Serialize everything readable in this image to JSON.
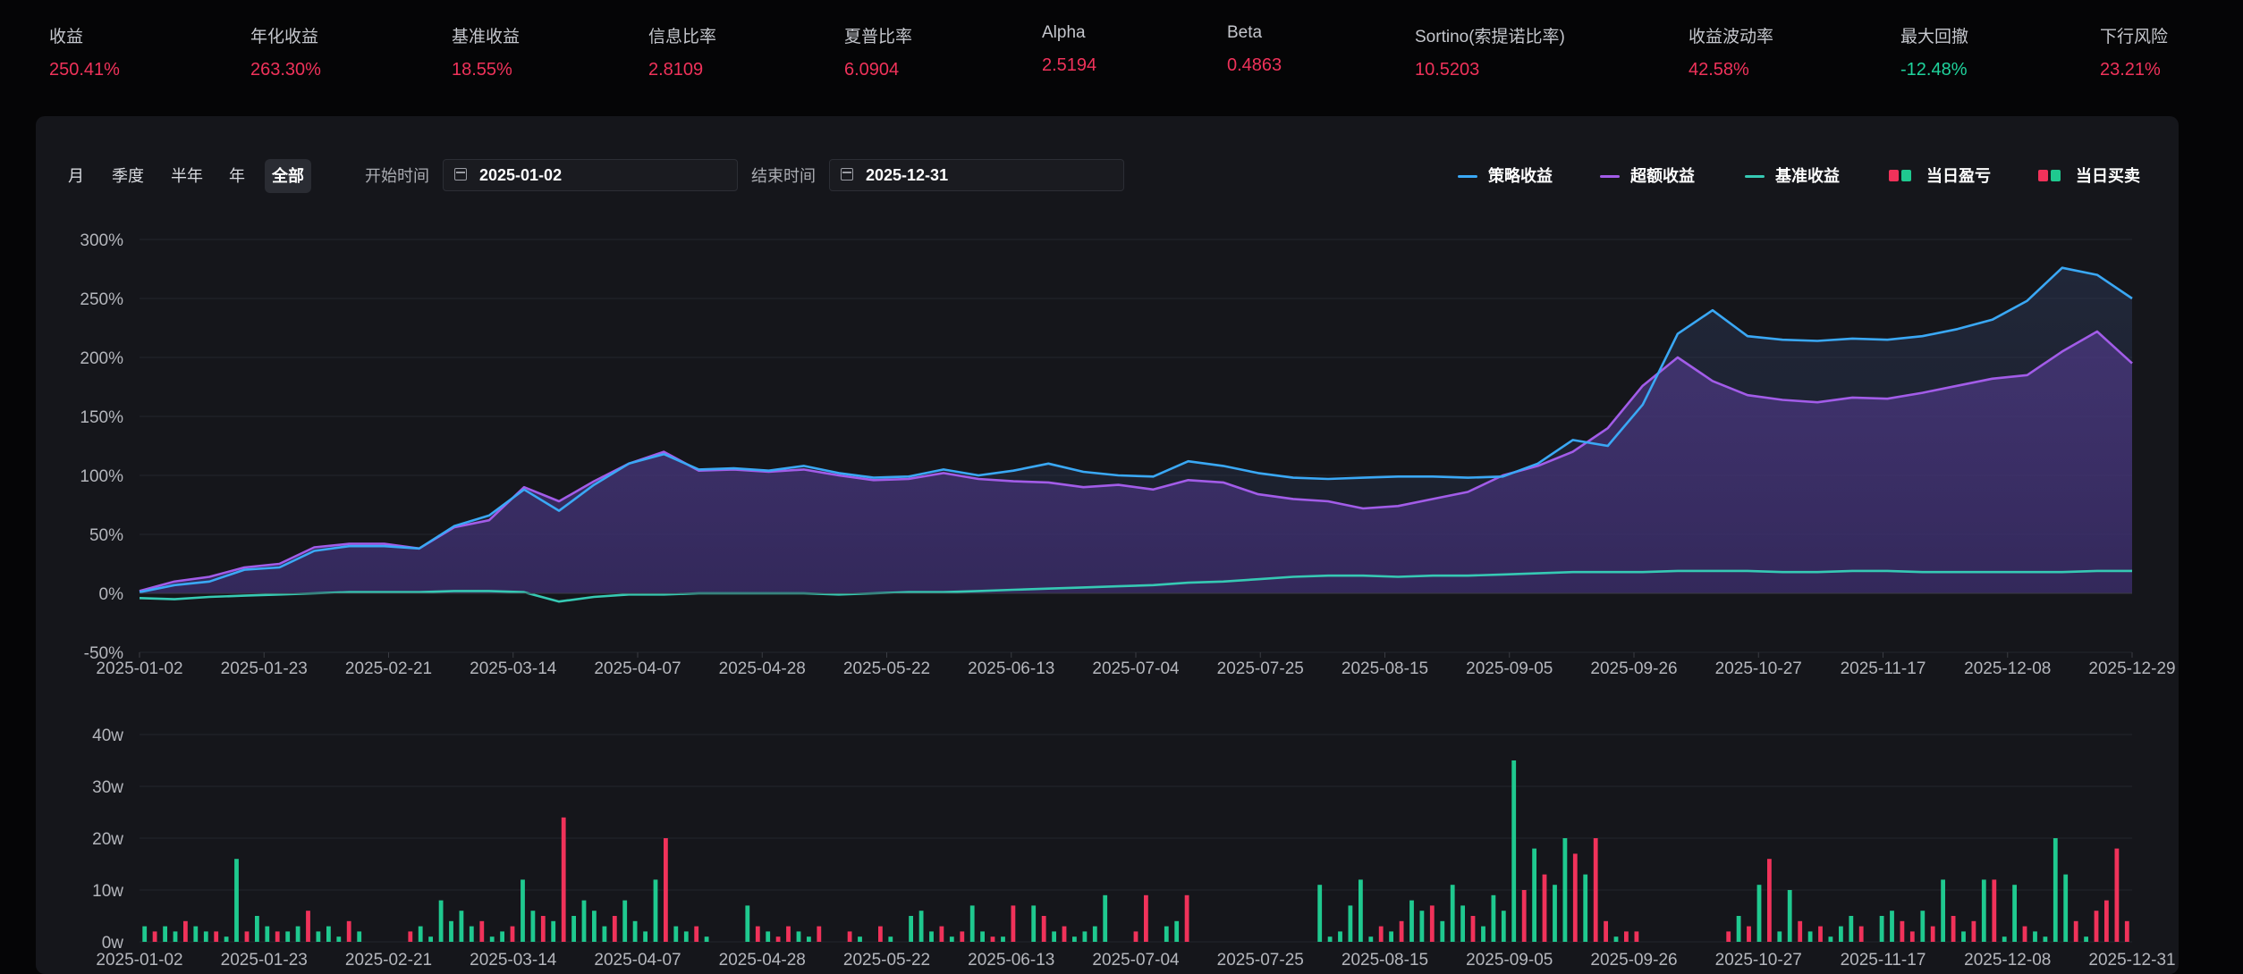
{
  "stats": [
    {
      "label": "收益",
      "value": "250.41%",
      "tone": "red"
    },
    {
      "label": "年化收益",
      "value": "263.30%",
      "tone": "red"
    },
    {
      "label": "基准收益",
      "value": "18.55%",
      "tone": "red"
    },
    {
      "label": "信息比率",
      "value": "2.8109",
      "tone": "red"
    },
    {
      "label": "夏普比率",
      "value": "6.0904",
      "tone": "red"
    },
    {
      "label": "Alpha",
      "value": "2.5194",
      "tone": "red"
    },
    {
      "label": "Beta",
      "value": "0.4863",
      "tone": "red"
    },
    {
      "label": "Sortino(索提诺比率)",
      "value": "10.5203",
      "tone": "red"
    },
    {
      "label": "收益波动率",
      "value": "42.58%",
      "tone": "red"
    },
    {
      "label": "最大回撤",
      "value": "-12.48%",
      "tone": "green"
    },
    {
      "label": "下行风险",
      "value": "23.21%",
      "tone": "red"
    }
  ],
  "toolbar": {
    "periods": [
      "月",
      "季度",
      "半年",
      "年",
      "全部"
    ],
    "active_period": "全部",
    "start_label": "开始时间",
    "start_value": "2025-01-02",
    "end_label": "结束时间",
    "end_value": "2025-12-31"
  },
  "legend": [
    {
      "name": "策略收益",
      "kind": "line",
      "colors": [
        "#3aa8f5"
      ]
    },
    {
      "name": "超额收益",
      "kind": "line",
      "colors": [
        "#a25ce8"
      ]
    },
    {
      "name": "基准收益",
      "kind": "line",
      "colors": [
        "#36c9b4"
      ]
    },
    {
      "name": "当日盈亏",
      "kind": "squares",
      "colors": [
        "#f0325a",
        "#1fc98f"
      ]
    },
    {
      "name": "当日买卖",
      "kind": "squares",
      "colors": [
        "#f0325a",
        "#1fc98f"
      ]
    }
  ],
  "colors": {
    "strategy": "#3aa8f5",
    "excess": "#a25ce8",
    "benchmark": "#36c9b4",
    "up": "#f0325a",
    "down": "#1fc98f",
    "grid": "#24262c",
    "axis_text": "#b4b6bc"
  },
  "chart_data": [
    {
      "type": "line",
      "ylim": [
        -50,
        300
      ],
      "y_ticks": [
        "300%",
        "250%",
        "200%",
        "150%",
        "100%",
        "50%",
        "0%",
        "-50%"
      ],
      "x_ticks": [
        "2025-01-02",
        "2025-01-23",
        "2025-02-21",
        "2025-03-14",
        "2025-04-07",
        "2025-04-28",
        "2025-05-22",
        "2025-06-13",
        "2025-07-04",
        "2025-07-25",
        "2025-08-15",
        "2025-09-05",
        "2025-09-26",
        "2025-10-27",
        "2025-11-17",
        "2025-12-08",
        "2025-12-29"
      ],
      "series": [
        {
          "name": "策略收益",
          "values": [
            1,
            7,
            10,
            20,
            22,
            36,
            40,
            40,
            38,
            57,
            66,
            88,
            70,
            92,
            110,
            118,
            105,
            106,
            104,
            108,
            102,
            98,
            99,
            105,
            100,
            104,
            110,
            103,
            100,
            99,
            112,
            108,
            102,
            98,
            97,
            98,
            99,
            99,
            98,
            99,
            110,
            130,
            125,
            160,
            220,
            240,
            218,
            215,
            214,
            216,
            215,
            218,
            224,
            232,
            248,
            276,
            270,
            250
          ]
        },
        {
          "name": "超额收益",
          "values": [
            2,
            10,
            14,
            22,
            25,
            39,
            42,
            42,
            38,
            56,
            62,
            90,
            78,
            95,
            110,
            120,
            104,
            105,
            103,
            105,
            100,
            96,
            97,
            102,
            97,
            95,
            94,
            90,
            92,
            88,
            96,
            94,
            84,
            80,
            78,
            72,
            74,
            80,
            86,
            100,
            108,
            120,
            140,
            176,
            200,
            180,
            168,
            164,
            162,
            166,
            165,
            170,
            176,
            182,
            185,
            205,
            222,
            195
          ]
        },
        {
          "name": "基准收益",
          "values": [
            -4,
            -5,
            -3,
            -2,
            -1,
            0,
            1,
            1,
            1,
            2,
            2,
            1,
            -7,
            -3,
            -1,
            -1,
            0,
            0,
            0,
            0,
            -1,
            0,
            1,
            1,
            2,
            3,
            4,
            5,
            6,
            7,
            9,
            10,
            12,
            14,
            15,
            15,
            14,
            15,
            15,
            16,
            17,
            18,
            18,
            18,
            19,
            19,
            19,
            18,
            18,
            19,
            19,
            18,
            18,
            18,
            18,
            18,
            19,
            19
          ]
        }
      ]
    },
    {
      "type": "bar",
      "ylim": [
        0,
        40
      ],
      "y_ticks": [
        "40w",
        "30w",
        "20w",
        "10w",
        "0w"
      ],
      "x_ticks": [
        "2025-01-02",
        "2025-01-23",
        "2025-02-21",
        "2025-03-14",
        "2025-04-07",
        "2025-04-28",
        "2025-05-22",
        "2025-06-13",
        "2025-07-04",
        "2025-07-25",
        "2025-08-15",
        "2025-09-05",
        "2025-09-26",
        "2025-10-27",
        "2025-11-17",
        "2025-12-08",
        "2025-12-31"
      ],
      "series": [
        {
          "name": "当日盈亏",
          "values": [
            3,
            -2,
            3,
            2,
            -4,
            3,
            2,
            -2,
            1,
            16,
            -2,
            5,
            3,
            -2,
            2,
            3,
            -6,
            2,
            3,
            1,
            -4,
            2,
            0,
            0,
            0,
            0,
            -2,
            3,
            1,
            8,
            4,
            6,
            3,
            -4,
            1,
            2,
            -3,
            12,
            6,
            -5,
            4,
            -24,
            5,
            8,
            6,
            3,
            -5,
            8,
            4,
            2,
            12,
            -20,
            3,
            2,
            -3,
            1,
            0,
            0,
            0,
            7,
            -3,
            2,
            -1,
            -3,
            2,
            1,
            -3,
            0,
            0,
            -2,
            1,
            0,
            -3,
            1,
            0,
            5,
            6,
            2,
            -3,
            1,
            -2,
            7,
            2,
            -1,
            1,
            -7,
            0,
            7,
            -5,
            2,
            -3,
            1,
            2,
            3,
            9,
            0,
            0,
            -2,
            -9,
            0,
            3,
            4,
            -9,
            0,
            0,
            0,
            0,
            0,
            0,
            0,
            0,
            0,
            0,
            0,
            0,
            11,
            1,
            2,
            7,
            12,
            1,
            -3,
            2,
            -4,
            8,
            6,
            -7,
            4,
            11,
            7,
            -5,
            3,
            9,
            6,
            35,
            -10,
            18,
            -13,
            11,
            20,
            -17,
            13,
            -20,
            -4,
            1,
            -2,
            -2,
            0,
            0,
            0,
            0,
            0,
            0,
            0,
            0,
            -2,
            5,
            -3,
            11,
            -16,
            2,
            10,
            -4,
            2,
            -3,
            1,
            3,
            5,
            -3,
            0,
            5,
            6,
            -4,
            -2,
            6,
            -3,
            12,
            -5,
            2,
            -4,
            12,
            -12,
            1,
            11,
            -3,
            2,
            1,
            20,
            13,
            -4,
            1,
            -6,
            -8,
            -18,
            -4
          ]
        }
      ]
    }
  ]
}
